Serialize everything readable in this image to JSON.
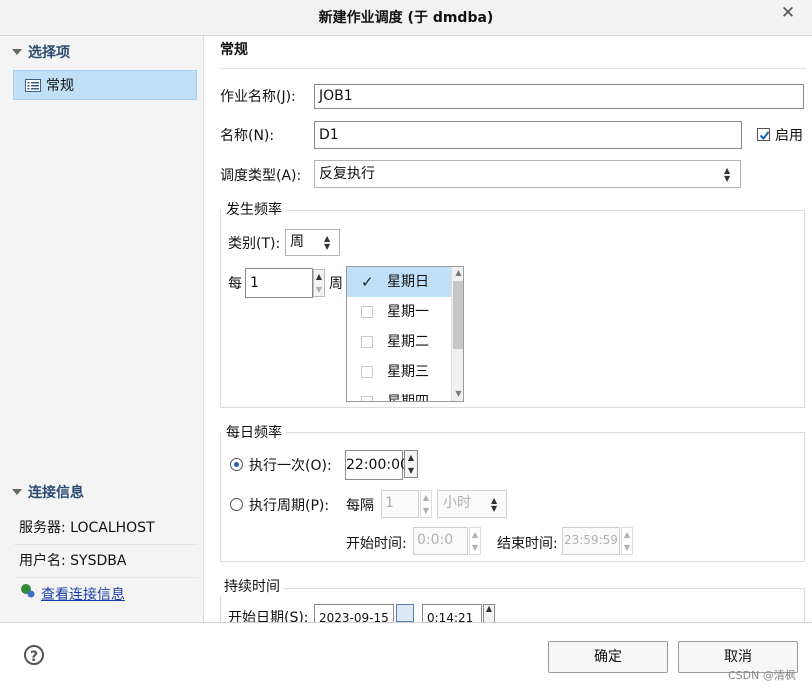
{
  "window": {
    "title": "新建作业调度 (于 dmdba)",
    "close_glyph": "✕"
  },
  "sidebar": {
    "options_header": "选择项",
    "nav_items": [
      {
        "label": "常规"
      }
    ],
    "conn_header": "连接信息",
    "server": "服务器: LOCALHOST",
    "user": "用户名: SYSDBA",
    "view_link": "查看连接信息"
  },
  "main": {
    "section_title": "常规",
    "job_name_label": "作业名称(J):",
    "job_name_value": "JOB1",
    "name_label": "名称(N):",
    "name_value": "D1",
    "enable_label": "启用",
    "schedule_type_label": "调度类型(A):",
    "schedule_type_value": "反复执行"
  },
  "freq": {
    "title": "发生频率",
    "category_label": "类别(T):",
    "category_value": "周",
    "every_label": "每",
    "every_value": "1",
    "unit_label": "周",
    "weekdays": [
      {
        "label": "星期日",
        "checked": true
      },
      {
        "label": "星期一",
        "checked": false
      },
      {
        "label": "星期二",
        "checked": false
      },
      {
        "label": "星期三",
        "checked": false
      },
      {
        "label": "星期四",
        "checked": false
      }
    ]
  },
  "daily": {
    "title": "每日频率",
    "once_label": "执行一次(O):",
    "once_time": "22:00:00",
    "period_label": "执行周期(P):",
    "every_label": "每隔",
    "every_value": "1",
    "unit_value": "小时",
    "start_label": "开始时间:",
    "start_value": "0:0:0",
    "end_label": "结束时间:",
    "end_value": "23:59:59"
  },
  "duration": {
    "title": "持续时间",
    "start_date_label": "开始日期(S):",
    "start_date_value": "2023-09-15",
    "start_time_value": "0:14:21"
  },
  "footer": {
    "help_glyph": "?",
    "ok_label": "确定",
    "cancel_label": "取消",
    "watermark": "CSDN @清枫"
  },
  "glyphs": {
    "up": "▲",
    "down": "▼",
    "check": "✓"
  },
  "colors": {
    "selection": "#bfe0f7",
    "section_header": "#2b4a73",
    "link": "#1a3ea8"
  }
}
